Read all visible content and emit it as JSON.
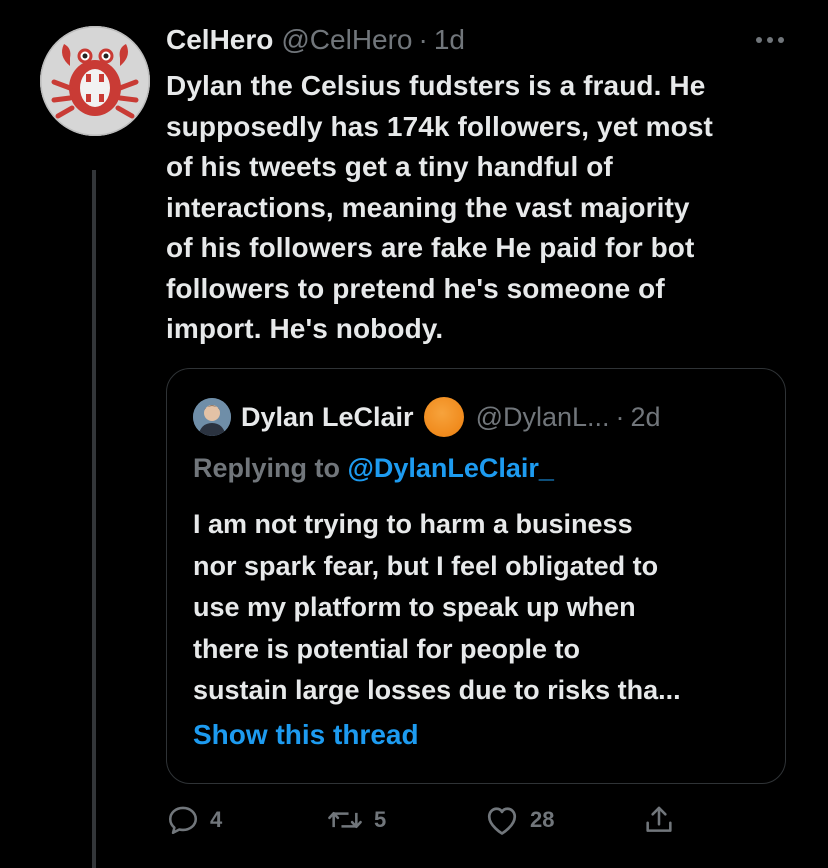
{
  "tweet": {
    "display_name": "CelHero",
    "handle": "@CelHero",
    "separator": "·",
    "time": "1d",
    "text": "Dylan the Celsius fudsters is a fraud.  He\nsupposedly has 174k followers, yet most\nof his tweets get a tiny handful of\ninteractions, meaning the vast majority\nof his followers are fake   He paid for bot\nfollowers to pretend he's someone of\nimport.  He's nobody.",
    "more_icon": "ellipsis-icon"
  },
  "quote": {
    "display_name": "Dylan LeClair",
    "badge_icon": "orange-circle-emoji",
    "handle": "@DylanL...",
    "separator": "·",
    "time": "2d",
    "replying_prefix": "Replying to",
    "replying_handle": "@DylanLeClair_",
    "text": "I am not trying to harm a business\nnor spark fear, but I feel obligated to\nuse my platform to speak up when\nthere is potential for people to\nsustain large losses due to risks tha...",
    "show_thread_label": "Show this thread"
  },
  "actions": {
    "reply_count": "4",
    "retweet_count": "5",
    "like_count": "28"
  },
  "colors": {
    "background": "#000000",
    "primary_text": "#e7e9ea",
    "secondary_text": "#71767b",
    "link_blue": "#1d9bf0",
    "border": "#2f3336",
    "badge_orange": "#f08a1c"
  }
}
